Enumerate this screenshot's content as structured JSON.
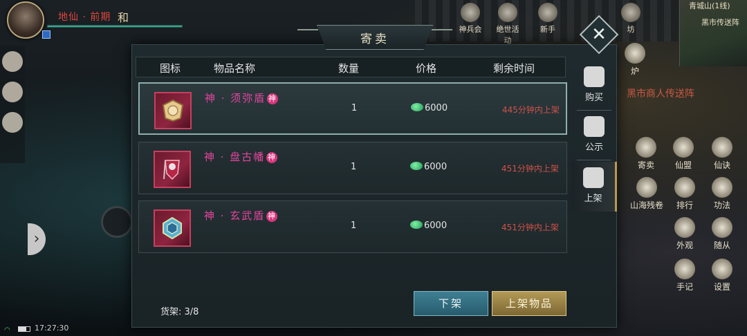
{
  "player": {
    "realm": "地仙 · 前期",
    "tag": "和",
    "hp_fraction": 1.0
  },
  "minimap": {
    "title": "青城山(1线)",
    "place": "黑市传送阵"
  },
  "top_menu": [
    {
      "label": "神兵会",
      "icon": "shield-icon"
    },
    {
      "label": "绝世活动",
      "icon": "star-icon"
    },
    {
      "label": "新手",
      "icon": "flag-icon"
    },
    {
      "label": "坊",
      "icon": "house-icon"
    }
  ],
  "hint": "黑市商人传送阵",
  "side_menu": [
    {
      "label": "寄卖",
      "icon": "coin-icon"
    },
    {
      "label": "仙盟",
      "icon": "banner-icon"
    },
    {
      "label": "仙诀",
      "icon": "scroll-icon"
    },
    {
      "label": "山海残卷",
      "icon": "map-icon"
    },
    {
      "label": "排行",
      "icon": "rank-icon"
    },
    {
      "label": "功法",
      "icon": "taiji-icon"
    },
    {
      "label": "外观",
      "icon": "robe-icon"
    },
    {
      "label": "随从",
      "icon": "pet-icon"
    },
    {
      "label": "手记",
      "icon": "book-icon"
    },
    {
      "label": "设置",
      "icon": "gear-icon"
    },
    {
      "label": "炉",
      "icon": "furnace-icon"
    }
  ],
  "status": {
    "time": "17:27:30",
    "battery_fraction": 0.7
  },
  "dialog": {
    "title": "寄卖",
    "close": "✕",
    "headers": {
      "icon": "图标",
      "name": "物品名称",
      "qty": "数量",
      "price": "价格",
      "time": "剩余时间"
    },
    "items": [
      {
        "name": "神 · 须弥盾",
        "mark": "神",
        "qty": "1",
        "price": "6000",
        "time": "445分钟内上架",
        "color_core": "#d9b572"
      },
      {
        "name": "神 · 盘古幡",
        "mark": "神",
        "qty": "1",
        "price": "6000",
        "time": "451分钟内上架",
        "color_core": "#c13050"
      },
      {
        "name": "神 · 玄武盾",
        "mark": "神",
        "qty": "1",
        "price": "6000",
        "time": "451分钟内上架",
        "color_core": "#5aa8d8"
      }
    ],
    "tabs": [
      {
        "label": "购买",
        "icon": "hand-coin-icon"
      },
      {
        "label": "公示",
        "icon": "notice-icon"
      },
      {
        "label": "上架",
        "icon": "list-stall-icon"
      }
    ],
    "shelf": "货架: 3/8",
    "btn_unlist": "下架",
    "btn_list": "上架物品"
  }
}
